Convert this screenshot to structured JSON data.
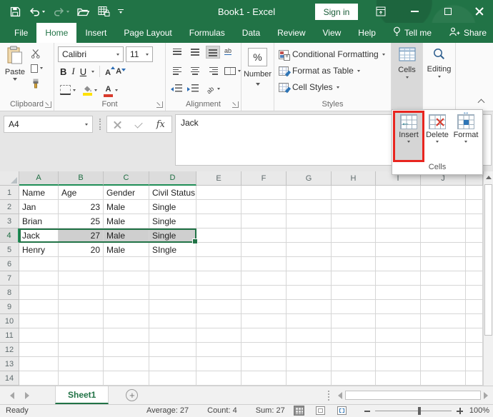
{
  "titlebar": {
    "title": "Book1 - Excel",
    "sign_in_label": "Sign in"
  },
  "ribbon_tabs": [
    {
      "label": "File",
      "active": false
    },
    {
      "label": "Home",
      "active": true
    },
    {
      "label": "Insert",
      "active": false
    },
    {
      "label": "Page Layout",
      "active": false
    },
    {
      "label": "Formulas",
      "active": false
    },
    {
      "label": "Data",
      "active": false
    },
    {
      "label": "Review",
      "active": false
    },
    {
      "label": "View",
      "active": false
    },
    {
      "label": "Help",
      "active": false
    },
    {
      "label": "Tell me",
      "active": false,
      "icon": "lightbulb-icon"
    },
    {
      "label": "Share",
      "active": false,
      "icon": "person-add-icon",
      "push_right": true
    }
  ],
  "ribbon": {
    "clipboard": {
      "group_label": "Clipboard",
      "paste_label": "Paste"
    },
    "font": {
      "group_label": "Font",
      "font_name": "Calibri",
      "font_size": "11",
      "bold_label": "B",
      "italic_label": "I",
      "underline_label": "U"
    },
    "alignment": {
      "group_label": "Alignment"
    },
    "number": {
      "label": "Number",
      "percent_label": "%"
    },
    "styles": {
      "group_label": "Styles",
      "items": [
        "Conditional Formatting",
        "Format as Table",
        "Cell Styles"
      ]
    },
    "cells": {
      "label": "Cells"
    },
    "editing": {
      "label": "Editing"
    }
  },
  "cells_flyout": {
    "group_label": "Cells",
    "buttons": [
      {
        "label": "Insert",
        "highlighted": true
      },
      {
        "label": "Delete",
        "highlighted": false
      },
      {
        "label": "Format",
        "highlighted": false
      }
    ]
  },
  "formula_bar": {
    "name_box": "A4",
    "fx_label": "fx",
    "formula_value": "Jack"
  },
  "grid": {
    "columns": [
      "A",
      "B",
      "C",
      "D",
      "E",
      "F",
      "G",
      "H",
      "I",
      "J"
    ],
    "selected_columns": [
      "A",
      "B",
      "C",
      "D"
    ],
    "row_count": 14,
    "selected_row": 4,
    "data": [
      {
        "row": 1,
        "cells": {
          "A": "Name",
          "B": "Age",
          "C": "Gender",
          "D": "Civil Status"
        }
      },
      {
        "row": 2,
        "cells": {
          "A": "Jan",
          "B": "23",
          "C": "Male",
          "D": "Single"
        }
      },
      {
        "row": 3,
        "cells": {
          "A": "Brian",
          "B": "25",
          "C": "Male",
          "D": "Single"
        }
      },
      {
        "row": 4,
        "cells": {
          "A": "Jack",
          "B": "27",
          "C": "Male",
          "D": "Single"
        }
      },
      {
        "row": 5,
        "cells": {
          "A": "Henry",
          "B": "20",
          "C": "Male",
          "D": "SIngle"
        }
      }
    ],
    "selection": {
      "active_cell": "A4",
      "range": "A4:D4"
    }
  },
  "sheet_bar": {
    "sheets": [
      {
        "name": "Sheet1",
        "active": true
      }
    ],
    "add_sheet_glyph": "+"
  },
  "status_bar": {
    "mode": "Ready",
    "aggregates": [
      "Average: 27",
      "Count: 4",
      "Sum: 27"
    ],
    "zoom_level": "100%"
  },
  "colors": {
    "excel_green": "#217346",
    "selection_border": "#217346",
    "selected_fill": "#cfcfcf",
    "insert_highlight_red": "#e8251f"
  }
}
